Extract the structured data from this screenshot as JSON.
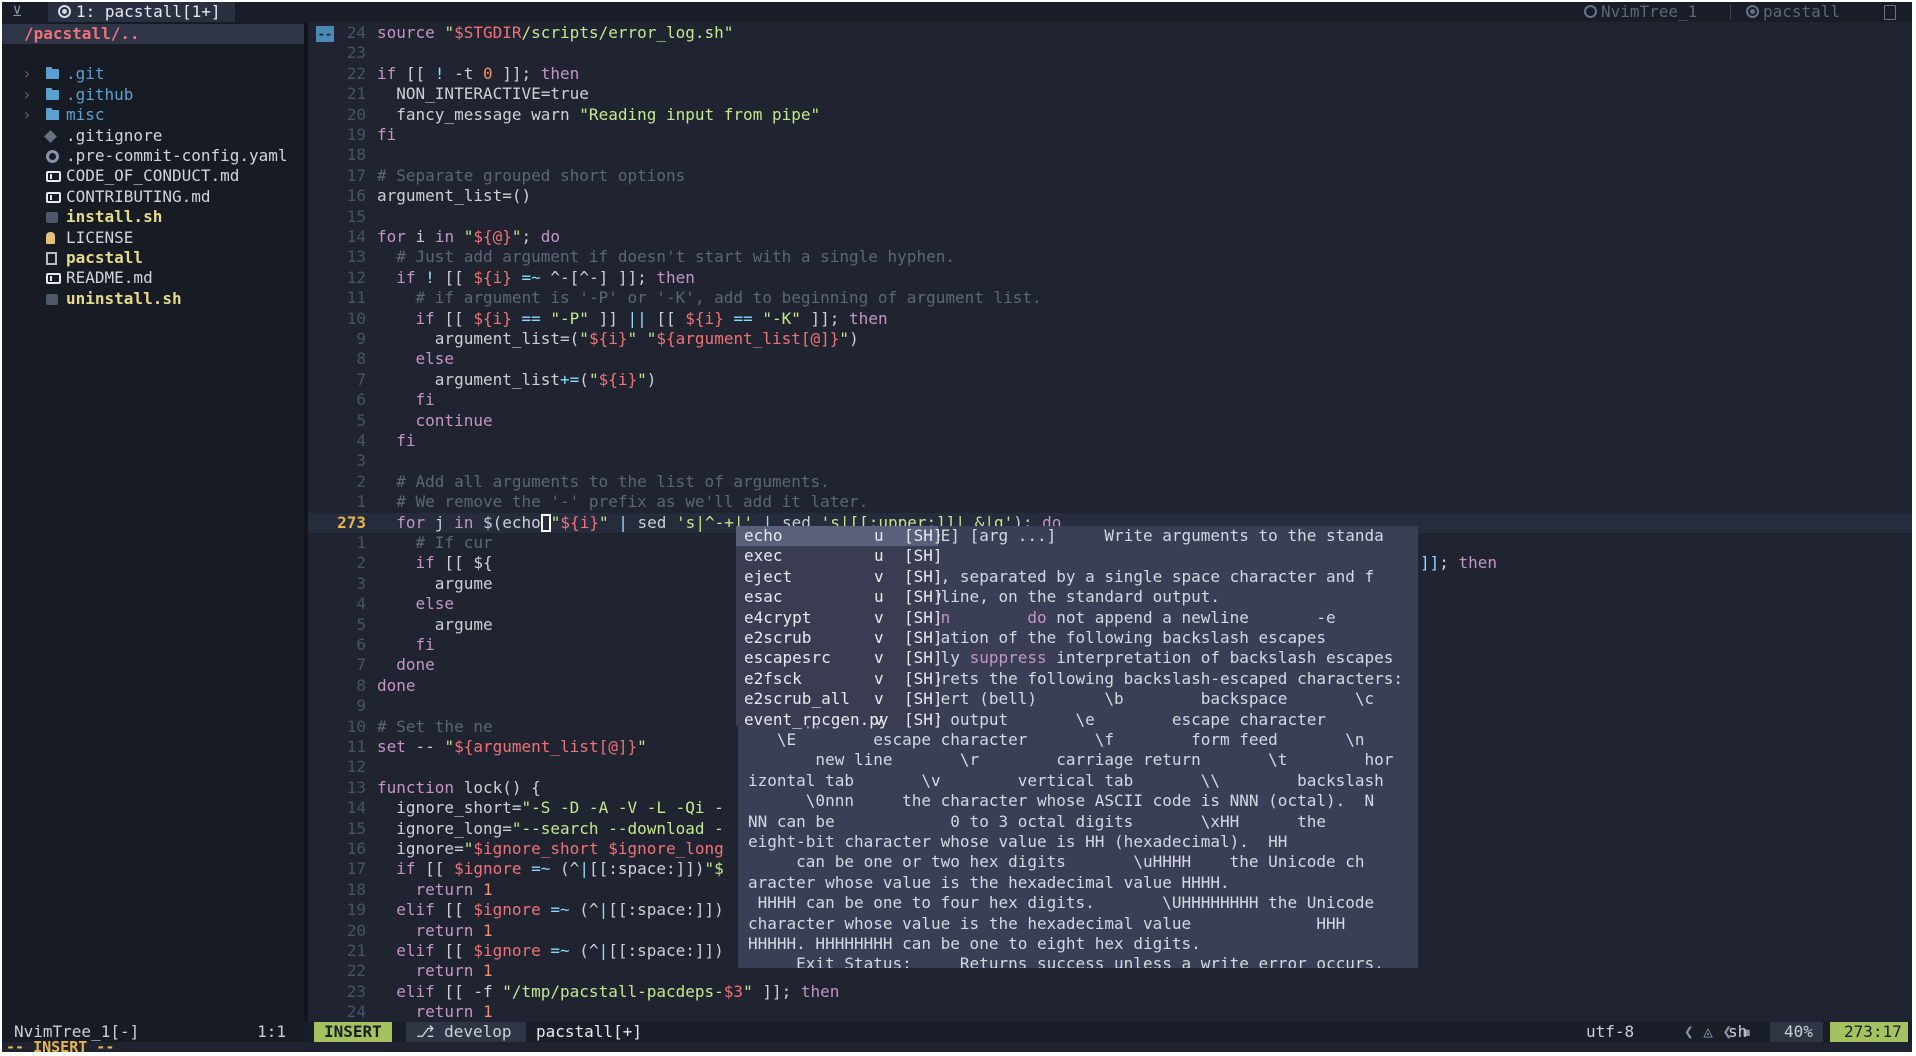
{
  "tabline": {
    "active_tab": "1: pacstall[1+]",
    "right_tabs": [
      "NvimTree_1",
      "pacstall"
    ]
  },
  "tree": {
    "root": "/pacstall/..",
    "items": [
      {
        "name": ".git",
        "type": "folder",
        "icon": "folder-icon"
      },
      {
        "name": ".github",
        "type": "folder",
        "icon": "folder-icon"
      },
      {
        "name": "misc",
        "type": "folder",
        "icon": "folder-icon"
      },
      {
        "name": ".gitignore",
        "type": "file",
        "icon": "git-icon"
      },
      {
        "name": ".pre-commit-config.yaml",
        "type": "file",
        "icon": "gear-icon"
      },
      {
        "name": "CODE_OF_CONDUCT.md",
        "type": "file",
        "icon": "markdown-icon"
      },
      {
        "name": "CONTRIBUTING.md",
        "type": "file",
        "icon": "markdown-icon"
      },
      {
        "name": "install.sh",
        "type": "file",
        "icon": "terminal-icon",
        "highlight": true
      },
      {
        "name": "LICENSE",
        "type": "file",
        "icon": "license-icon"
      },
      {
        "name": "pacstall",
        "type": "file",
        "icon": "document-icon",
        "highlight": true
      },
      {
        "name": "README.md",
        "type": "file",
        "icon": "markdown-icon"
      },
      {
        "name": "uninstall.sh",
        "type": "file",
        "icon": "terminal-icon",
        "highlight": true
      }
    ]
  },
  "editor": {
    "sign": "--",
    "line_numbers": [
      "24",
      "23",
      "22",
      "21",
      "20",
      "19",
      "18",
      "17",
      "16",
      "15",
      "14",
      "13",
      "12",
      "11",
      "10",
      "9",
      "8",
      "7",
      "6",
      "5",
      "4",
      "3",
      "2",
      "1",
      "273",
      "1",
      "2",
      "3",
      "4",
      "5",
      "6",
      "7",
      "8",
      "9",
      "10",
      "11",
      "12",
      "13",
      "14",
      "15",
      "16",
      "17",
      "18",
      "19",
      "20",
      "21",
      "22",
      "23",
      "24"
    ],
    "lines": [
      "source \"$STGDIR/scripts/error_log.sh\"",
      "",
      "if [[ ! -t 0 ]]; then",
      "  NON_INTERACTIVE=true",
      "  fancy_message warn \"Reading input from pipe\"",
      "fi",
      "",
      "# Separate grouped short options",
      "argument_list=()",
      "",
      "for i in \"${@}\"; do",
      "  # Just add argument if doesn't start with a single hyphen.",
      "  if ! [[ ${i} =~ ^-[^-] ]]; then",
      "    # if argument is '-P' or '-K', add to beginning of argument list.",
      "    if [[ ${i} == \"-P\" ]] || [[ ${i} == \"-K\" ]]; then",
      "      argument_list=(\"${i}\" \"${argument_list[@]}\")",
      "    else",
      "      argument_list+=(\"${i}\")",
      "    fi",
      "    continue",
      "  fi",
      "",
      "  # Add all arguments to the list of arguments.",
      "  # We remove the '-' prefix as we'll add it later.",
      "  for j in $(echo▯\"${i}\" | sed 's|^-+|' | sed 's|[[:upper:]]| &|g'); do",
      "    # If cur",
      "    if [[ ${",
      "      argume",
      "    else",
      "      argume",
      "    fi",
      "  done",
      "done",
      "",
      "# Set the ne",
      "set -- \"${argument_list[@]}\"",
      "",
      "function lock() {",
      "  ignore_short=\"-S -D -A -V -L -Qi -",
      "  ignore_long=\"--search --download -",
      "  ignore=\"$ignore_short $ignore_long",
      "  if [[ $ignore =~ (^|[[:space:]])\"$",
      "    return 1",
      "  elif [[ $ignore =~ (^|[[:space:]])",
      "    return 1",
      "  elif [[ $ignore =~ (^|[[:space:]])",
      "    return 1",
      "  elif [[ -f \"/tmp/pacstall-pacdeps-$3\" ]]; then",
      "    return 1"
    ],
    "overflow_right": "]]; then"
  },
  "completion": {
    "items": [
      {
        "name": "echo",
        "mark": "u",
        "kind": "[SH]"
      },
      {
        "name": "exec",
        "mark": "u",
        "kind": "[SH]"
      },
      {
        "name": "eject",
        "mark": "v",
        "kind": "[SH]"
      },
      {
        "name": "esac",
        "mark": "u",
        "kind": "[SH]"
      },
      {
        "name": "e4crypt",
        "mark": "v",
        "kind": "[SH]"
      },
      {
        "name": "e2scrub",
        "mark": "v",
        "kind": "[SH]"
      },
      {
        "name": "escapesrc",
        "mark": "v",
        "kind": "[SH]"
      },
      {
        "name": "e2fsck",
        "mark": "v",
        "kind": "[SH]"
      },
      {
        "name": "e2scrub_all",
        "mark": "v",
        "kind": "[SH]"
      },
      {
        "name": "event_rpcgen.py",
        "mark": "v",
        "kind": "[SH]"
      }
    ]
  },
  "doc": {
    "lines": [
      " man echo: echo [-neE] [arg ...]     Write arguments to the standa",
      "rd output.",
      "    Display the ARGs, separated by a single space character and f",
      "ollowed by a     newline, on the standard output.",
      "    Options:       -n        do not append a newline       -e",
      "    enable interpretation of the following backslash escapes",
      "  -E        explicitly suppress interpretation of backslash escapes",
      "       `echo' interprets the following backslash-escaped characters:",
      "        \\a        alert (bell)       \\b        backspace       \\c",
      "    suppress further output       \\e        escape character",
      "   \\E        escape character       \\f        form feed       \\n",
      "       new line       \\r        carriage return       \\t        hor",
      "izontal tab       \\v        vertical tab       \\\\        backslash",
      "      \\0nnn     the character whose ASCII code is NNN (octal).  N",
      "NN can be            0 to 3 octal digits       \\xHH      the",
      "eight-bit character whose value is HH (hexadecimal).  HH",
      "     can be one or two hex digits       \\uHHHH    the Unicode ch",
      "aracter whose value is the hexadecimal value HHHH.",
      " HHHH can be one to four hex digits.       \\UHHHHHHHH the Unicode",
      "character whose value is the hexadecimal value             HHH",
      "HHHHH. HHHHHHHH can be one to eight hex digits.",
      "     Exit Status:     Returns success unless a write error occurs."
    ]
  },
  "statusline": {
    "tree_name": "NvimTree_1[-]",
    "tree_pos": "1:1",
    "mode": "INSERT",
    "branch": "develop",
    "file": "pacstall[+]",
    "encoding": "utf-8",
    "filetype": "sh",
    "percent": "40%",
    "position": "273:17"
  },
  "cmdline": {
    "text": "-- INSERT --"
  },
  "colors": {
    "background": "#1f2430",
    "accent_green": "#a5c261",
    "line_number_current": "#e6b450",
    "popup": "#3b3f56"
  }
}
